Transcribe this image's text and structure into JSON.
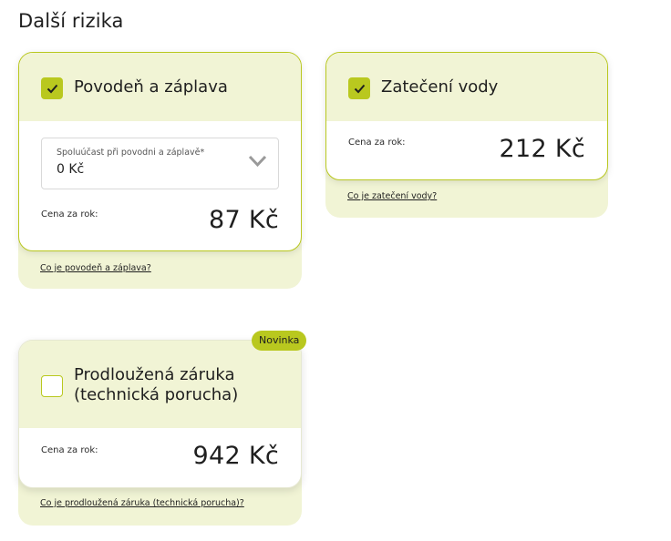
{
  "section_title": "Další rizika",
  "flood": {
    "title": "Povodeň a záplava",
    "checked": true,
    "select_label": "Spoluúčast při povodni a záplavě*",
    "select_value": "0 Kč",
    "price_label": "Cena za rok:",
    "price_value": "87 Kč",
    "link": "Co je povodeň a záplava?"
  },
  "water": {
    "title": "Zatečení vody",
    "checked": true,
    "price_label": "Cena za rok:",
    "price_value": "212 Kč",
    "link": "Co je zatečení vody?"
  },
  "warranty": {
    "badge": "Novinka",
    "title_line1": "Prodloužená záruka",
    "title_line2": "(technická porucha)",
    "checked": false,
    "price_label": "Cena za rok:",
    "price_value": "942 Kč",
    "link": "Co je prodloužená záruka (technická porucha)?"
  },
  "icons": {
    "check": "check-icon",
    "chevron": "chevron-down-icon"
  },
  "colors": {
    "accent": "#b9c81f",
    "tint": "#f1f4d5",
    "text": "#1f1f1f"
  }
}
